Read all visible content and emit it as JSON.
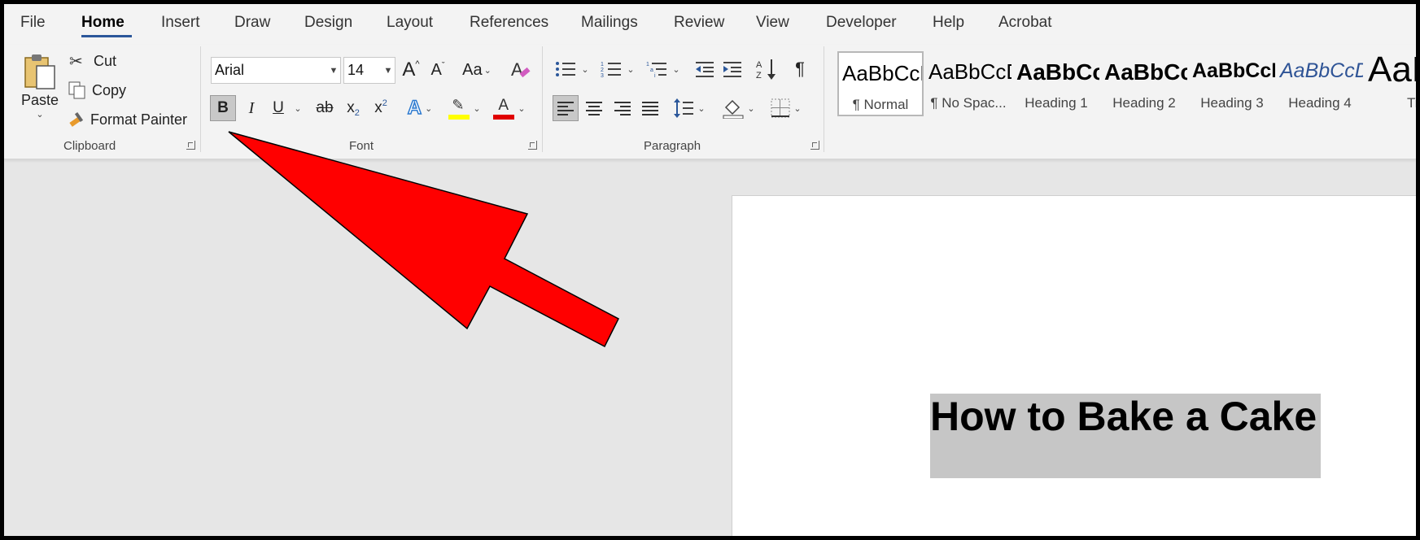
{
  "tabs": [
    "File",
    "Home",
    "Insert",
    "Draw",
    "Design",
    "Layout",
    "References",
    "Mailings",
    "Review",
    "View",
    "Developer",
    "Help",
    "Acrobat"
  ],
  "active_tab": "Home",
  "clipboard": {
    "paste": "Paste",
    "cut": "Cut",
    "copy": "Copy",
    "format_painter": "Format Painter",
    "group": "Clipboard"
  },
  "font": {
    "family": "Arial",
    "size": "14",
    "grow": "A",
    "shrink": "A",
    "change_case": "Aa",
    "bold": "B",
    "italic": "I",
    "underline": "U",
    "strike": "ab",
    "subscript": "x",
    "superscript": "x",
    "sub_mark": "2",
    "sup_mark": "2",
    "text_effects": "A",
    "font_color": "A",
    "group": "Font"
  },
  "paragraph": {
    "group": "Paragraph",
    "pilcrow": "¶"
  },
  "styles": [
    {
      "sample": "AaBbCcDd",
      "name": "¶ Normal"
    },
    {
      "sample": "AaBbCcDd",
      "name": "¶ No Spac..."
    },
    {
      "sample": "AaBbCcD",
      "name": "Heading 1"
    },
    {
      "sample": "AaBbCcD",
      "name": "Heading 2"
    },
    {
      "sample": "AaBbCcD",
      "name": "Heading 3"
    },
    {
      "sample": "AaBbCcDd",
      "name": "Heading 4"
    },
    {
      "sample": "AaB",
      "name": "Title"
    }
  ],
  "document": {
    "heading": "How to Bake a Cake"
  },
  "colors": {
    "accent": "#2b579a",
    "highlight": "#ffff00",
    "font_color_bar": "#e00000",
    "arrow": "#ff0000",
    "selection": "#c6c6c6"
  }
}
